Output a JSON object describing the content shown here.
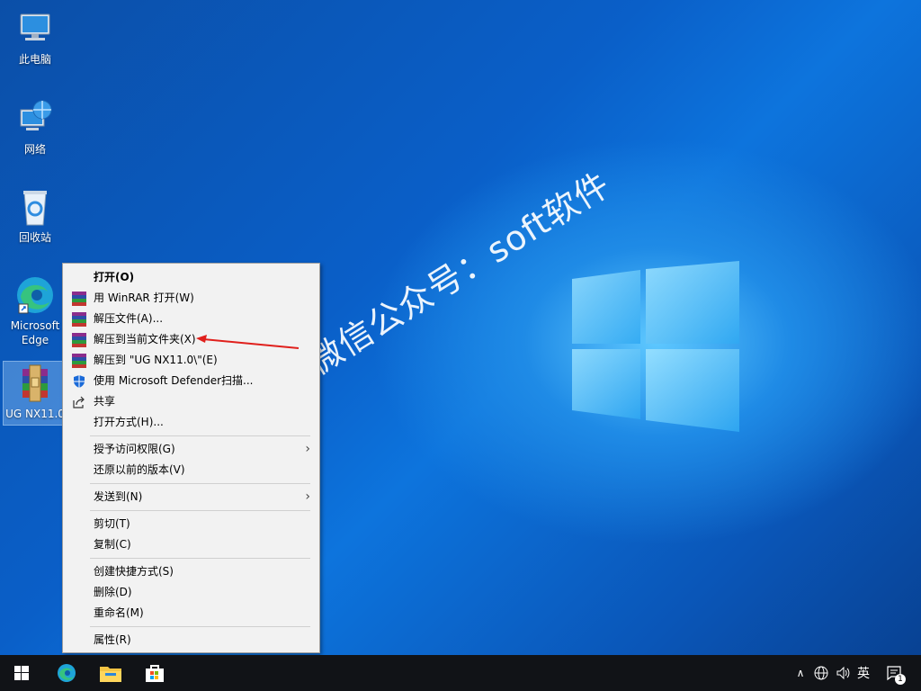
{
  "desktop": {
    "icons": [
      {
        "label": "此电脑",
        "icon": "this-pc-icon"
      },
      {
        "label": "网络",
        "icon": "network-icon"
      },
      {
        "label": "回收站",
        "icon": "recycle-bin-icon"
      },
      {
        "label": "Microsoft Edge",
        "icon": "edge-icon"
      },
      {
        "label": "UG NX11.0",
        "icon": "winrar-archive-icon"
      }
    ]
  },
  "watermark": "微信公众号：soft软件",
  "context_menu": {
    "items": [
      {
        "label": "打开(O)",
        "bold": true
      },
      {
        "label": "用 WinRAR 打开(W)",
        "icon": "winrar-icon"
      },
      {
        "label": "解压文件(A)...",
        "icon": "winrar-icon"
      },
      {
        "label": "解压到当前文件夹(X)",
        "icon": "winrar-icon"
      },
      {
        "label": "解压到 \"UG NX11.0\\\"(E)",
        "icon": "winrar-icon"
      },
      {
        "label": "使用 Microsoft Defender扫描...",
        "icon": "defender-shield-icon"
      },
      {
        "label": "共享",
        "icon": "share-icon"
      },
      {
        "label": "打开方式(H)..."
      },
      {
        "label": "授予访问权限(G)",
        "submenu": true
      },
      {
        "label": "还原以前的版本(V)"
      },
      {
        "label": "发送到(N)",
        "submenu": true
      },
      {
        "label": "剪切(T)"
      },
      {
        "label": "复制(C)"
      },
      {
        "label": "创建快捷方式(S)"
      },
      {
        "label": "删除(D)"
      },
      {
        "label": "重命名(M)"
      },
      {
        "label": "属性(R)"
      }
    ]
  },
  "taskbar": {
    "pinned": [
      "start-button",
      "edge-icon",
      "file-explorer-icon",
      "store-icon"
    ],
    "tray": {
      "ime_label": "英",
      "notification_count": "1"
    }
  },
  "colors": {
    "menu_bg": "#f2f2f2",
    "annotation_arrow": "#e0201c",
    "taskbar_bg": "#111317"
  }
}
